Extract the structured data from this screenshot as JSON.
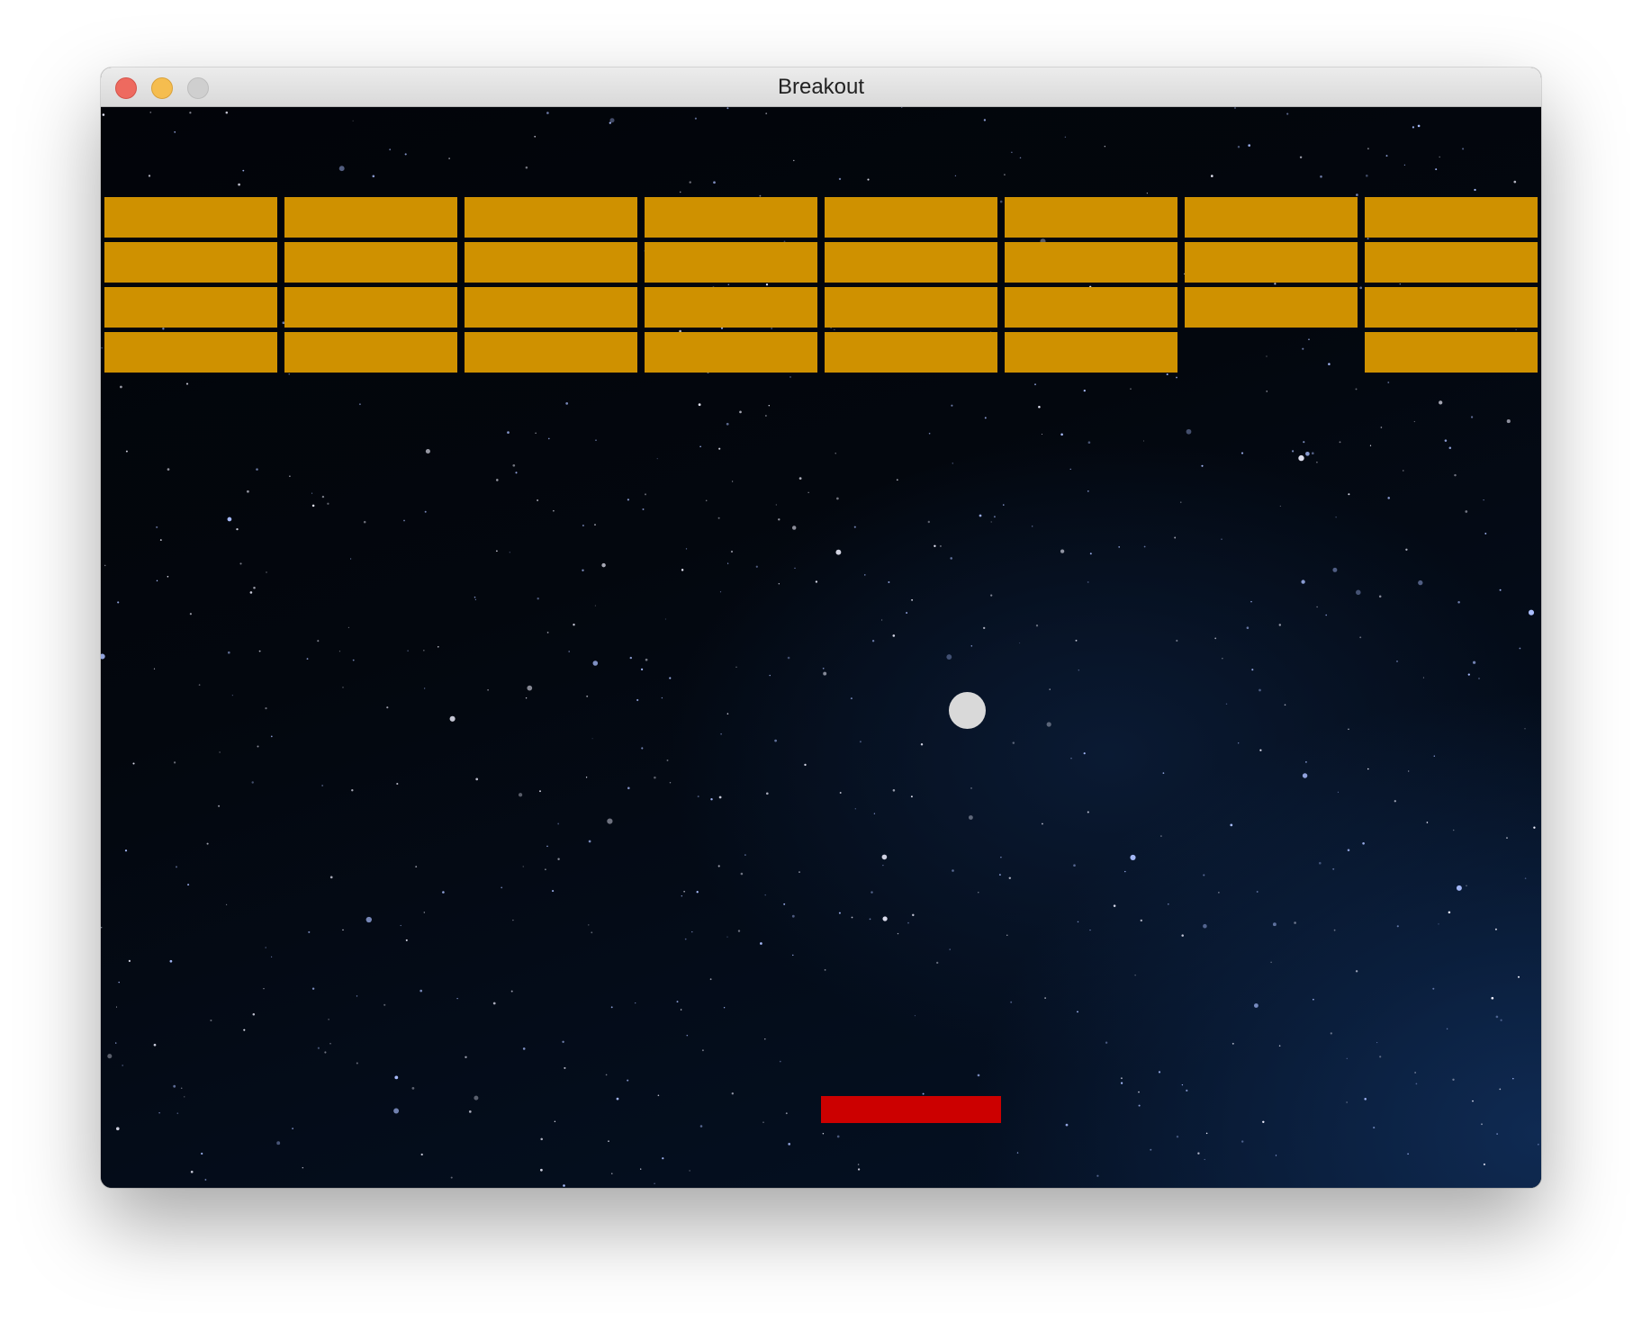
{
  "window": {
    "title": "Breakout"
  },
  "game": {
    "brick_color": "#cf9100",
    "paddle_color": "#cc0000",
    "ball_color": "#d9d9d9",
    "brick_rows": 4,
    "brick_columns": 8,
    "missing_bricks": [
      [
        3,
        6
      ]
    ]
  }
}
